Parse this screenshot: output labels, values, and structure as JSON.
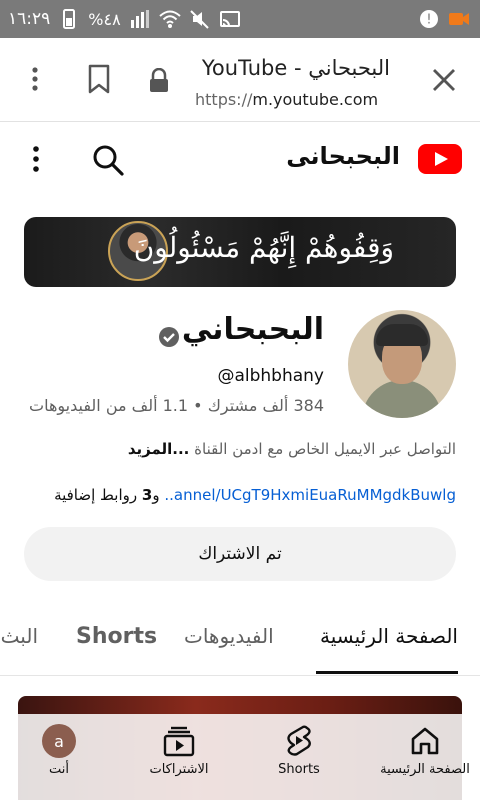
{
  "status_bar": {
    "time": "١٦:٢٩",
    "battery": "%٤٨"
  },
  "browser": {
    "page_title": "البحبحاني - YouTube",
    "url_scheme": "https://",
    "url_host": "m.youtube.com"
  },
  "header": {
    "channel_title": "البحبحانى"
  },
  "banner": {
    "calligraphy": "وَقِفُوهُمْ إِنَّهُمْ مَسْئُولُونَ"
  },
  "channel": {
    "name": "البحبحاني",
    "handle": "@albhbhany",
    "subscribers": "384 ألف مشترك",
    "separator": "•",
    "videos": "1.1 ألف من الفيديوهات",
    "description": "التواصل عبر الايميل الخاص مع ادمن القناة",
    "more": "...المزيد",
    "link_text": "annel/UCgT9HxmiEuaRuMMgdkBuwlg..",
    "links_prefix": "و",
    "links_count": "3",
    "links_suffix": "روابط إضافية"
  },
  "subscribe": {
    "label": "تم الاشتراك"
  },
  "tabs": [
    {
      "label": "الصفحة الرئيسية"
    },
    {
      "label": "الفيديوهات"
    },
    {
      "label": "Shorts"
    },
    {
      "label": "البث"
    }
  ],
  "bottom_nav": [
    {
      "label": "الصفحة الرئيسية"
    },
    {
      "label": "Shorts"
    },
    {
      "label": "الاشتراكات"
    },
    {
      "label": "أنت",
      "avatar_letter": "a"
    }
  ],
  "colors": {
    "youtube_red": "#ff0000",
    "link_blue": "#065fd4",
    "status_bar": "#7a7a7a"
  }
}
